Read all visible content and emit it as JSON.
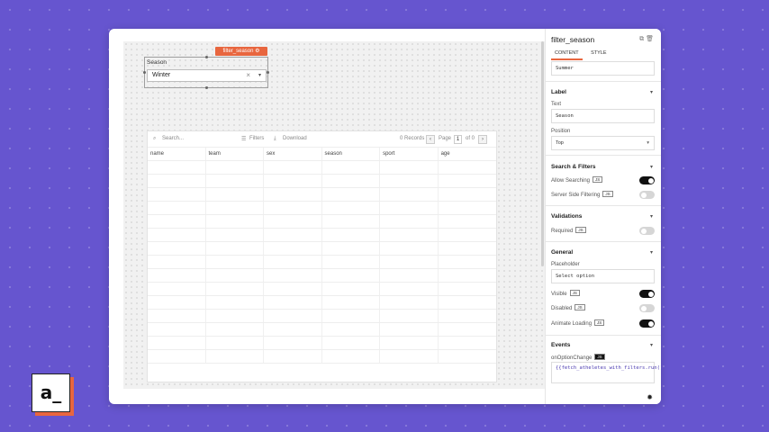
{
  "logo": {
    "text": "a_"
  },
  "canvas": {
    "widget_tag": "filter_season ⚙",
    "select": {
      "label": "Season",
      "value": "Winter",
      "clear_icon": "close-icon",
      "chevron_icon": "chevron-down-icon"
    },
    "table": {
      "search_placeholder": "Search...",
      "filters_label": "Filters",
      "download_label": "Download",
      "records": "0 Records",
      "page_label": "Page",
      "page_num": "1",
      "of_label": "of 0",
      "columns": [
        "name",
        "team",
        "sex",
        "season",
        "sport",
        "age"
      ]
    }
  },
  "panel": {
    "title": "filter_season",
    "tabs": [
      "CONTENT",
      "STYLE"
    ],
    "top_value": "Summer",
    "label_section": {
      "title": "Label",
      "text_label": "Text",
      "text_value": "Season",
      "position_label": "Position",
      "position_value": "Top"
    },
    "search_section": {
      "title": "Search & Filters",
      "allow_searching": "Allow Searching",
      "server_side": "Server Side Filtering"
    },
    "validations_section": {
      "title": "Validations",
      "required": "Required"
    },
    "general_section": {
      "title": "General",
      "placeholder_label": "Placeholder",
      "placeholder_value": "Select option",
      "visible": "Visible",
      "disabled": "Disabled",
      "animate": "Animate Loading"
    },
    "events_section": {
      "title": "Events",
      "on_change": "onOptionChange",
      "code": "{{fetch_atheletes_with_filters.run()}}"
    },
    "js": "JS"
  },
  "toggles": {
    "allow_searching": true,
    "server_side": false,
    "required": false,
    "visible": true,
    "disabled": false,
    "animate": true
  },
  "colors": {
    "background": "#6655cf",
    "accent": "#e8663f"
  }
}
